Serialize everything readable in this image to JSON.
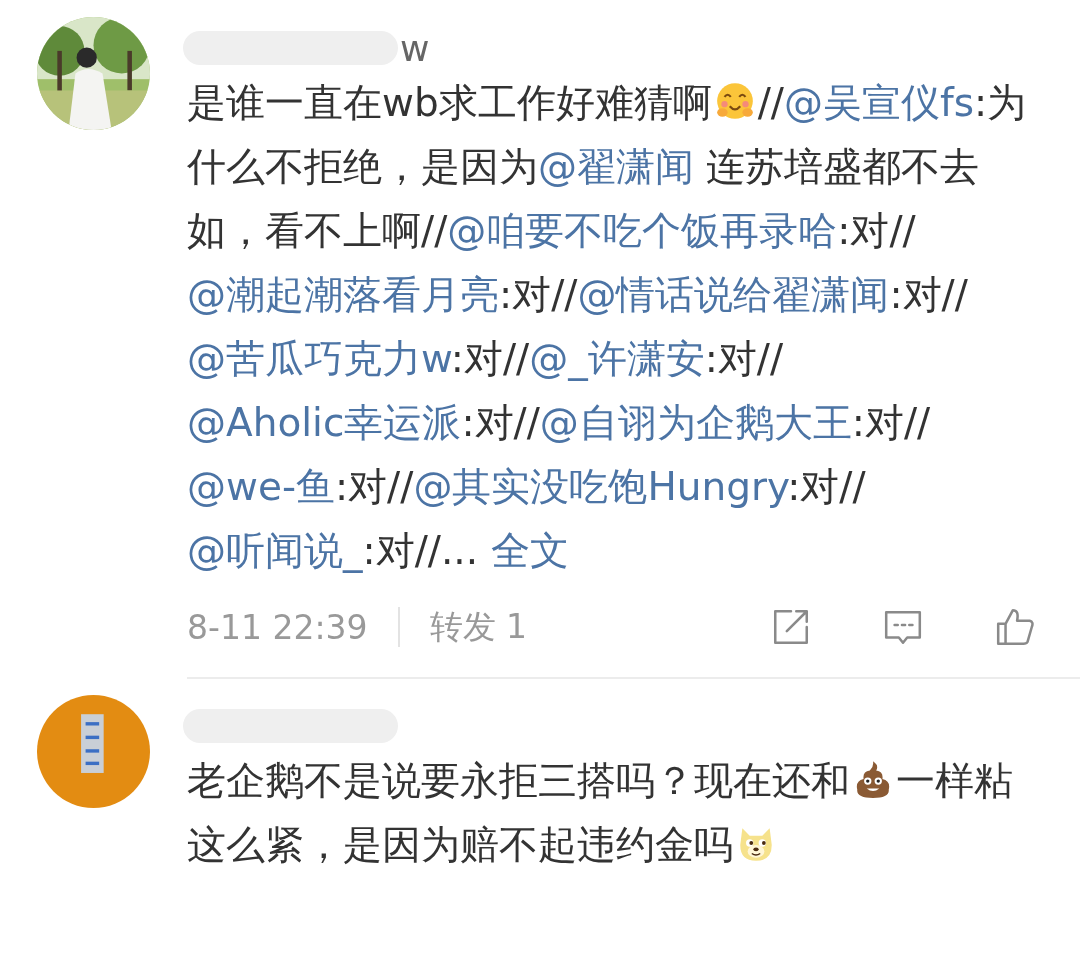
{
  "comments": [
    {
      "username_visible": "w",
      "segments": [
        {
          "kind": "text",
          "text": "是谁一直在wb求工作好难猜啊"
        },
        {
          "kind": "smiley"
        },
        {
          "kind": "text",
          "text": "//"
        },
        {
          "kind": "mention",
          "text": "@吴宣仪fs"
        },
        {
          "kind": "text",
          "text": ":为什么不拒绝，是因为"
        },
        {
          "kind": "mention",
          "text": "@翟潇闻"
        },
        {
          "kind": "text",
          "text": " 连苏培盛都不去如，看不上啊//"
        },
        {
          "kind": "mention",
          "text": "@咱要不吃个饭再录哈"
        },
        {
          "kind": "text",
          "text": ":对//"
        },
        {
          "kind": "mention",
          "text": "@潮起潮落看月亮"
        },
        {
          "kind": "text",
          "text": ":对//"
        },
        {
          "kind": "mention",
          "text": "@情话说给翟潇闻"
        },
        {
          "kind": "text",
          "text": ":对//"
        },
        {
          "kind": "mention",
          "text": "@苦瓜巧克力w"
        },
        {
          "kind": "text",
          "text": ":对//"
        },
        {
          "kind": "mention",
          "text": "@_许潇安"
        },
        {
          "kind": "text",
          "text": ":对//"
        },
        {
          "kind": "mention",
          "text": "@Aholic幸运派"
        },
        {
          "kind": "text",
          "text": ":对//"
        },
        {
          "kind": "mention",
          "text": "@自诩为企鹅大王"
        },
        {
          "kind": "text",
          "text": ":对//"
        },
        {
          "kind": "mention",
          "text": "@we-鱼"
        },
        {
          "kind": "text",
          "text": ":对//"
        },
        {
          "kind": "mention",
          "text": "@其实没吃饱Hungry"
        },
        {
          "kind": "text",
          "text": ":对//"
        },
        {
          "kind": "mention",
          "text": "@听闻说_"
        },
        {
          "kind": "text",
          "text": ":对//... "
        },
        {
          "kind": "link",
          "text": "全文"
        }
      ],
      "footer": {
        "time": "8-11 22:39",
        "repost": "转发 1"
      }
    },
    {
      "segments": [
        {
          "kind": "text",
          "text": "老企鹅不是说要永拒三搭吗？现在还和"
        },
        {
          "kind": "poop"
        },
        {
          "kind": "text",
          "text": "一样粘这么紧，是因为赔不起违约金吗"
        },
        {
          "kind": "doge"
        }
      ]
    }
  ]
}
